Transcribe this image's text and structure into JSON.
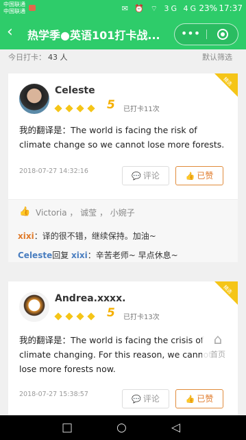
{
  "status_bar": {
    "carrier_top": "中国联通",
    "carrier_bottom": "中国联通",
    "battery": "23%",
    "time": "17:37",
    "signal": "3G 4G"
  },
  "header": {
    "back_icon": "chevron-left",
    "title": "热学季●英语101打卡战...",
    "more_icon": "•••",
    "close_icon": "target-circle"
  },
  "summary": {
    "label": "今日打卡：",
    "count": "43 人",
    "filter": "默认筛选"
  },
  "posts": [
    {
      "badge": "精选",
      "name": "Celeste",
      "level": "5",
      "checkins": "已打卡11次",
      "text": "我的翻译是：The world is facing the risk of climate change so we cannot lose more forests.",
      "timestamp": "2018-07-27 14:32:16",
      "comment_label": "评论",
      "like_label": "已赞",
      "likes_names": "Victoria ，  诚莹 ，  小婉子",
      "comments": [
        {
          "author": "xixi",
          "text": "：译的很不错，继续保持。加油~"
        },
        {
          "author": "Celeste",
          "reply_word": "回复 ",
          "reply_to": "xixi",
          "text": "：辛苦老师~ 早点休息~"
        }
      ]
    },
    {
      "badge": "精选",
      "name": "Andrea.xxxx.",
      "level": "5",
      "checkins": "已打卡13次",
      "text": "我的翻译是：The world is facing the crisis of climate changing. For this reason, we cannot lose more forests now.",
      "timestamp": "2018-07-27 15:38:57",
      "comment_label": "评论",
      "like_label": "已赞"
    }
  ],
  "home_button": {
    "label": "首页"
  },
  "colors": {
    "brand_green": "#2ecc6a",
    "accent_orange": "#e07a2a",
    "gold": "#f5c518"
  }
}
